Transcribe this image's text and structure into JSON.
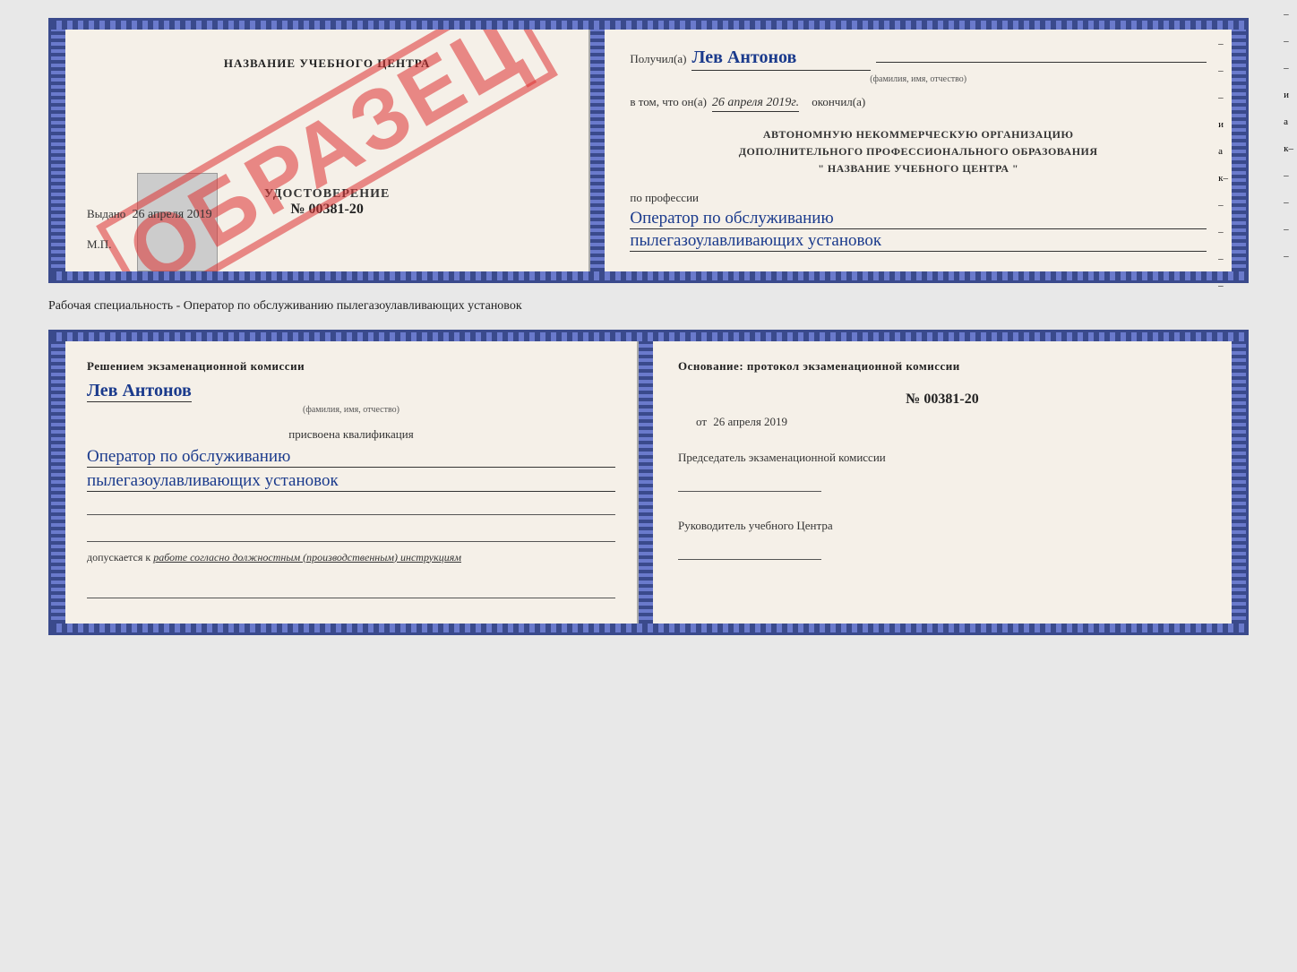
{
  "topCertificate": {
    "leftPage": {
      "trainingCenterLabel": "НАЗВАНИЕ УЧЕБНОГО ЦЕНТРА",
      "watermark": "ОБРАЗЕЦ",
      "udostoverenie": "УДОСТОВЕРЕНИЕ",
      "certNumber": "№ 00381-20",
      "issuedLabel": "Выдано",
      "issuedDate": "26 апреля 2019",
      "mpLabel": "М.П."
    },
    "rightPage": {
      "receivedLabel": "Получил(а)",
      "recipientName": "Лев Антонов",
      "fioHint": "(фамилия, имя, отчество)",
      "inThatLabel": "в том, что он(а)",
      "completedDate": "26 апреля 2019г.",
      "completedLabel": "окончил(а)",
      "org1": "АВТОНОМНУЮ НЕКОММЕРЧЕСКУЮ ОРГАНИЗАЦИЮ",
      "org2": "ДОПОЛНИТЕЛЬНОГО ПРОФЕССИОНАЛЬНОГО ОБРАЗОВАНИЯ",
      "org3": "\"   НАЗВАНИЕ УЧЕБНОГО ЦЕНТРА   \"",
      "professionLabel": "по профессии",
      "profession1": "Оператор по обслуживанию",
      "profession2": "пылегазоулавливающих установок"
    }
  },
  "middleCaption": {
    "text": "Рабочая специальность - Оператор по обслуживанию пылегазоулавливающих установок"
  },
  "bottomCertificate": {
    "leftPage": {
      "decisionText": "Решением экзаменационной комиссии",
      "recipientName": "Лев Антонов",
      "fioHint": "(фамилия, имя, отчество)",
      "assignedLabel": "присвоена квалификация",
      "profession1": "Оператор по обслуживанию",
      "profession2": "пылегазоулавливающих установок",
      "допускаетсяLabel": "допускается к",
      "допускаетсяValue": "работе согласно должностным (производственным) инструкциям"
    },
    "rightPage": {
      "basisLabel": "Основание: протокол экзаменационной комиссии",
      "protocolNumber": "№ 00381-20",
      "protocolDatePrefix": "от",
      "protocolDate": "26 апреля 2019",
      "chairmanLabel": "Председатель экзаменационной комиссии",
      "headLabel": "Руководитель учебного Центра"
    }
  }
}
